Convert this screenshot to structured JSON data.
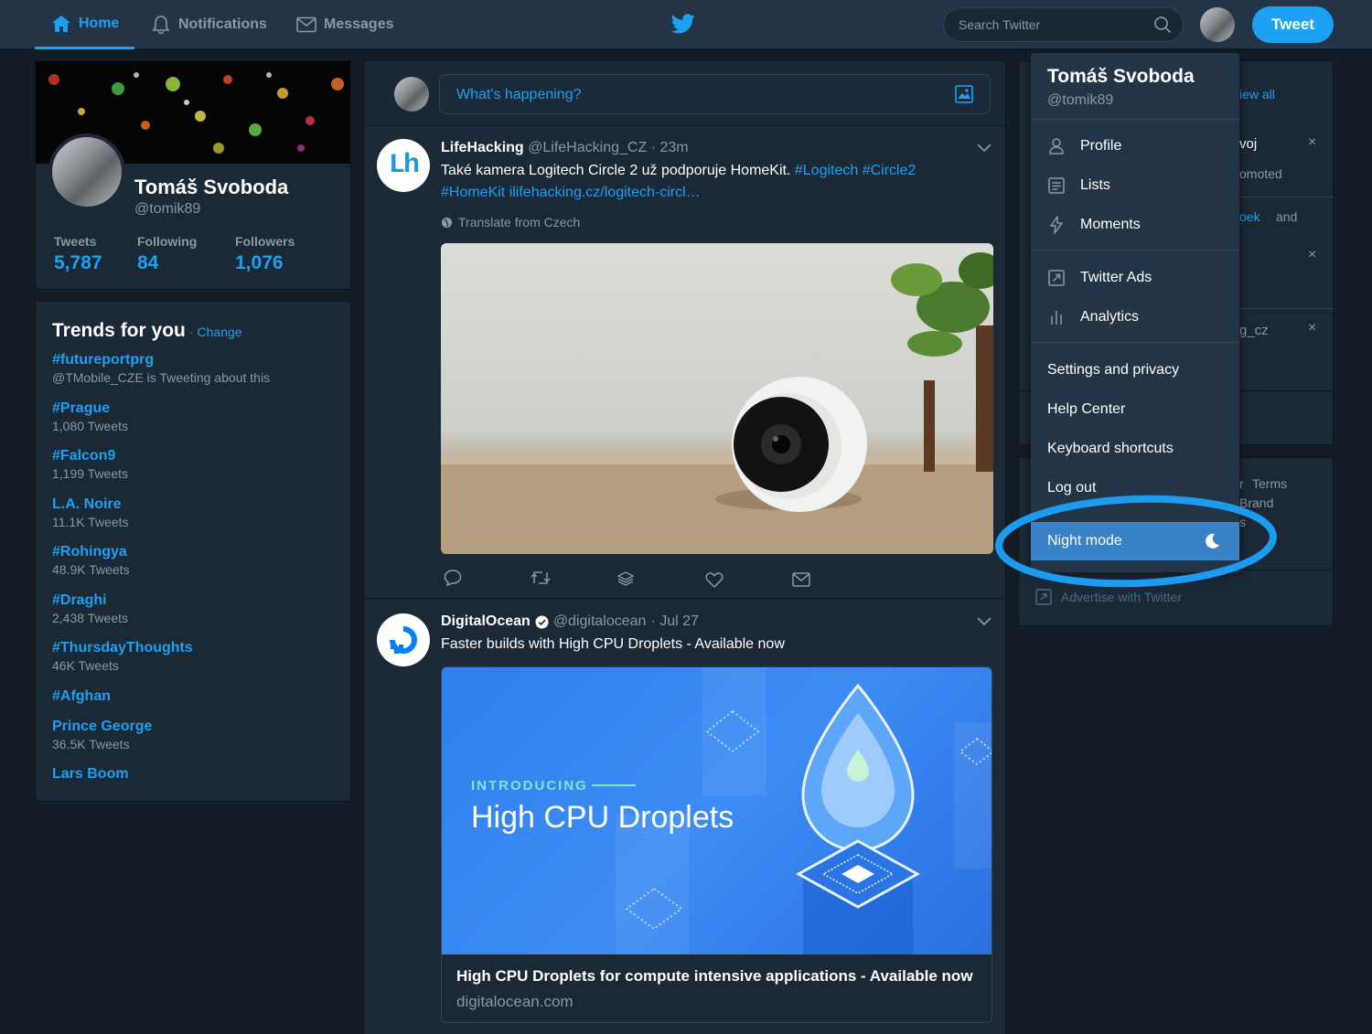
{
  "nav": {
    "home": "Home",
    "notifications": "Notifications",
    "messages": "Messages",
    "search_placeholder": "Search Twitter",
    "tweet_button": "Tweet"
  },
  "profile": {
    "name": "Tomáš Svoboda",
    "handle": "@tomik89",
    "stats": [
      {
        "label": "Tweets",
        "value": "5,787"
      },
      {
        "label": "Following",
        "value": "84"
      },
      {
        "label": "Followers",
        "value": "1,076"
      }
    ]
  },
  "trends": {
    "title": "Trends for you",
    "change": "Change",
    "items": [
      {
        "name": "#futureportprg",
        "sub": "@TMobile_CZE is Tweeting about this"
      },
      {
        "name": "#Prague",
        "sub": "1,080 Tweets"
      },
      {
        "name": "#Falcon9",
        "sub": "1,199 Tweets"
      },
      {
        "name": "L.A. Noire",
        "sub": "11.1K Tweets"
      },
      {
        "name": "#Rohingya",
        "sub": "48.9K Tweets"
      },
      {
        "name": "#Draghi",
        "sub": "2,438 Tweets"
      },
      {
        "name": "#ThursdayThoughts",
        "sub": "46K Tweets"
      },
      {
        "name": "#Afghan",
        "sub": ""
      },
      {
        "name": "Prince George",
        "sub": "36.5K Tweets"
      },
      {
        "name": "Lars Boom",
        "sub": ""
      }
    ]
  },
  "compose": {
    "placeholder": "What's happening?"
  },
  "tweets": [
    {
      "name": "LifeHacking",
      "handle": "@LifeHacking_CZ",
      "time": "· 23m",
      "avatar_text": "Lh",
      "text": "Také kamera Logitech Circle 2 už podporuje HomeKit.",
      "hashtags": "#Logitech #Circle2",
      "line2": "#HomeKit ilifehacking.cz/logitech-circl…",
      "translate": "Translate from Czech"
    },
    {
      "name": "DigitalOcean",
      "handle": "@digitalocean",
      "time": "· Jul 27",
      "text": "Faster builds with High CPU Droplets - Available now",
      "card": {
        "kicker": "INTRODUCING",
        "headline": "High CPU Droplets",
        "title": "High CPU Droplets for compute intensive applications - Available now",
        "domain": "digitalocean.com"
      }
    }
  ],
  "right_sidebar": {
    "view_all": "iew all",
    "snippets": [
      "voj",
      "omoted",
      "oek",
      "and",
      "g_cz",
      "r",
      "Terms",
      "Brand",
      "s"
    ],
    "advertise": "Advertise with Twitter"
  },
  "dropdown": {
    "name": "Tomáš Svoboda",
    "handle": "@tomik89",
    "items": [
      {
        "label": "Profile",
        "icon": "person-icon"
      },
      {
        "label": "Lists",
        "icon": "list-icon"
      },
      {
        "label": "Moments",
        "icon": "lightning-icon"
      },
      {
        "label": "Twitter Ads",
        "icon": "external-arrow-icon"
      },
      {
        "label": "Analytics",
        "icon": "bar-chart-icon"
      },
      {
        "label": "Settings and privacy"
      },
      {
        "label": "Help Center"
      },
      {
        "label": "Keyboard shortcuts"
      },
      {
        "label": "Log out"
      },
      {
        "label": "Night mode",
        "icon": "moon-icon"
      }
    ]
  },
  "colors": {
    "accent": "#1da1f2",
    "background": "#141d26",
    "panel": "#1b2836",
    "topbar": "#243447",
    "highlight_ring": "#1d9bf0"
  }
}
